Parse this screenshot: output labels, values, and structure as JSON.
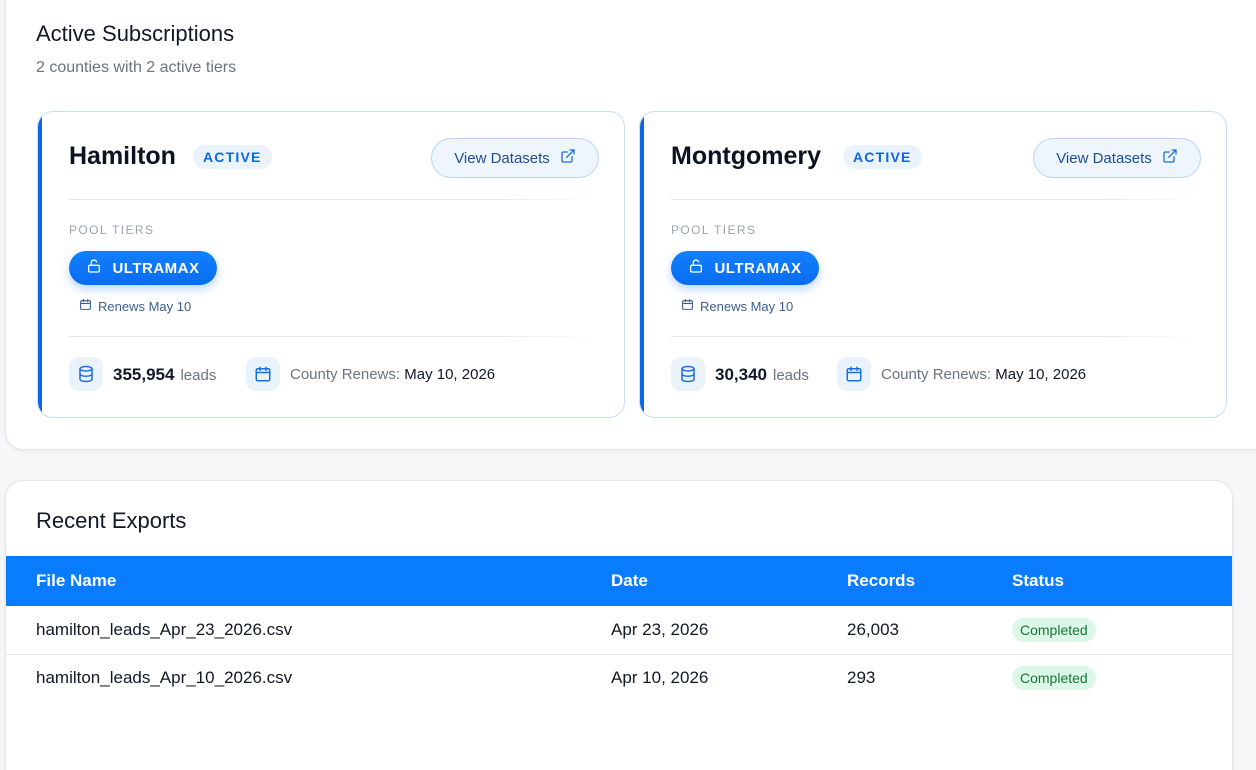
{
  "subscriptions": {
    "title": "Active Subscriptions",
    "subtitle": "2 counties with 2 active tiers",
    "cards": [
      {
        "county": "Hamilton",
        "status": "ACTIVE",
        "view_label": "View Datasets",
        "pool_label": "POOL TIERS",
        "tier": "ULTRAMAX",
        "tier_renews": "Renews May 10",
        "leads_count": "355,954",
        "leads_unit": "leads",
        "county_renews_label": "County Renews:",
        "county_renews_date": "May 10, 2026"
      },
      {
        "county": "Montgomery",
        "status": "ACTIVE",
        "view_label": "View Datasets",
        "pool_label": "POOL TIERS",
        "tier": "ULTRAMAX",
        "tier_renews": "Renews May 10",
        "leads_count": "30,340",
        "leads_unit": "leads",
        "county_renews_label": "County Renews:",
        "county_renews_date": "May 10, 2026"
      }
    ]
  },
  "exports": {
    "title": "Recent Exports",
    "columns": [
      "File Name",
      "Date",
      "Records",
      "Status"
    ],
    "rows": [
      {
        "file": "hamilton_leads_Apr_23_2026.csv",
        "date": "Apr 23, 2026",
        "records": "26,003",
        "status": "Completed"
      },
      {
        "file": "hamilton_leads_Apr_10_2026.csv",
        "date": "Apr 10, 2026",
        "records": "293",
        "status": "Completed"
      }
    ]
  },
  "colors": {
    "accent": "#0a7cff",
    "card_border": "#c8def8",
    "status_bg": "#dcf7e6",
    "status_text": "#0f7a3c"
  },
  "icons": [
    "external-link-icon",
    "lock-icon",
    "calendar-icon",
    "database-icon"
  ]
}
